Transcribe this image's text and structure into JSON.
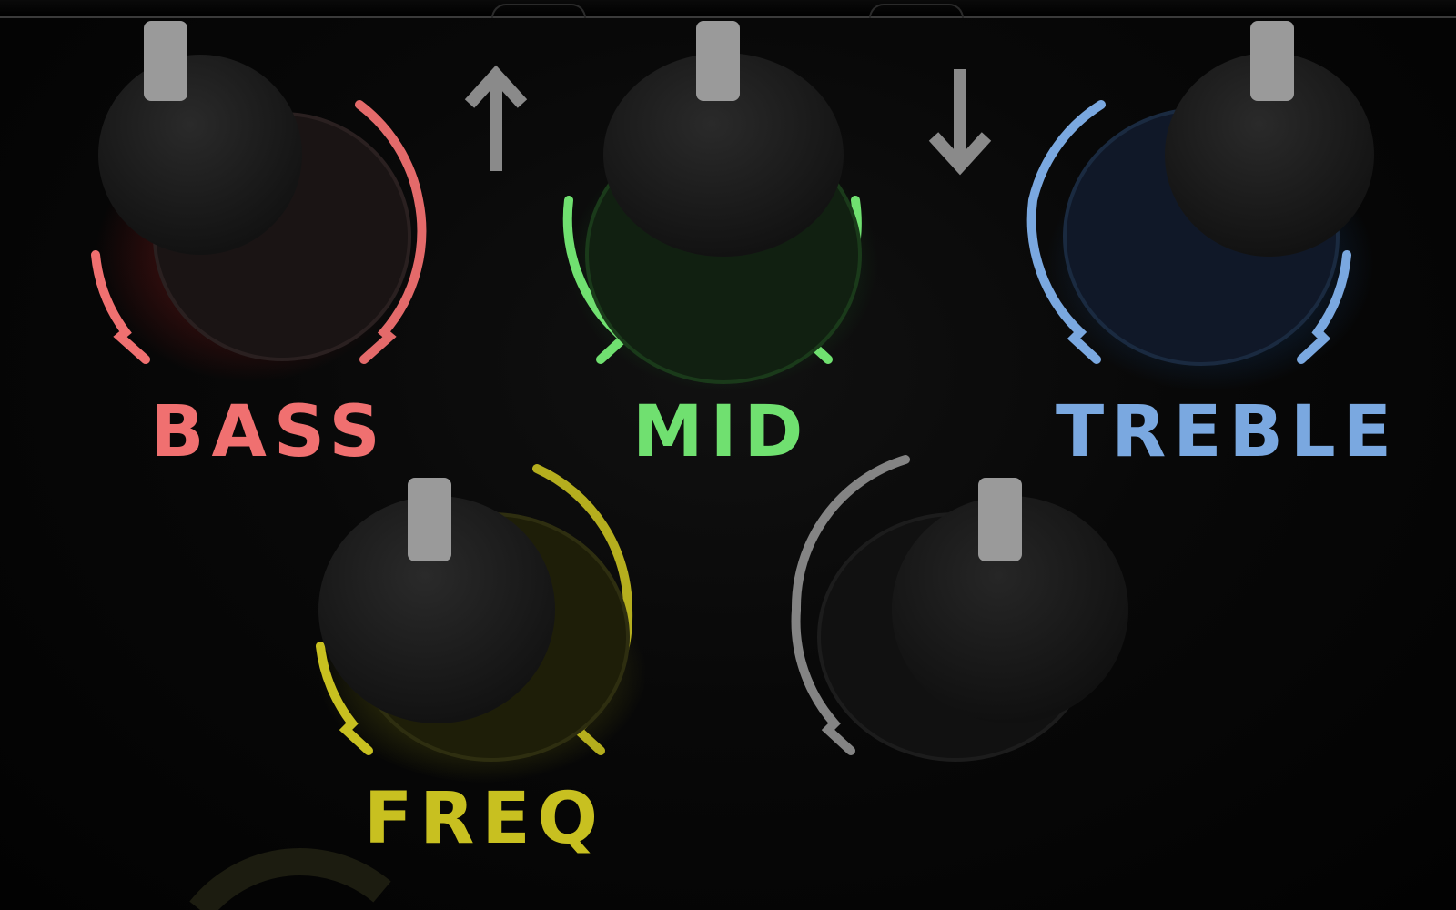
{
  "knobs": [
    {
      "id": "bass",
      "label": "BASS",
      "color": "#f07070",
      "glow": "#b02020"
    },
    {
      "id": "mid",
      "label": "MID",
      "color": "#70e070",
      "glow": "#20a030"
    },
    {
      "id": "treble",
      "label": "TREBLE",
      "color": "#7aa8e0",
      "glow": "#2060b0"
    },
    {
      "id": "freq",
      "label": "FREQ",
      "color": "#c8c020",
      "glow": "#a0a010"
    },
    {
      "id": "unlabeled",
      "label": "",
      "color": "#9a9a9a",
      "glow": "#202020"
    }
  ],
  "icons": {
    "up": "arrow-up-icon",
    "down": "arrow-down-icon"
  },
  "colors": {
    "background": "#050505",
    "pointer": "#9a9a9a",
    "arrow": "#8a8a8a"
  }
}
